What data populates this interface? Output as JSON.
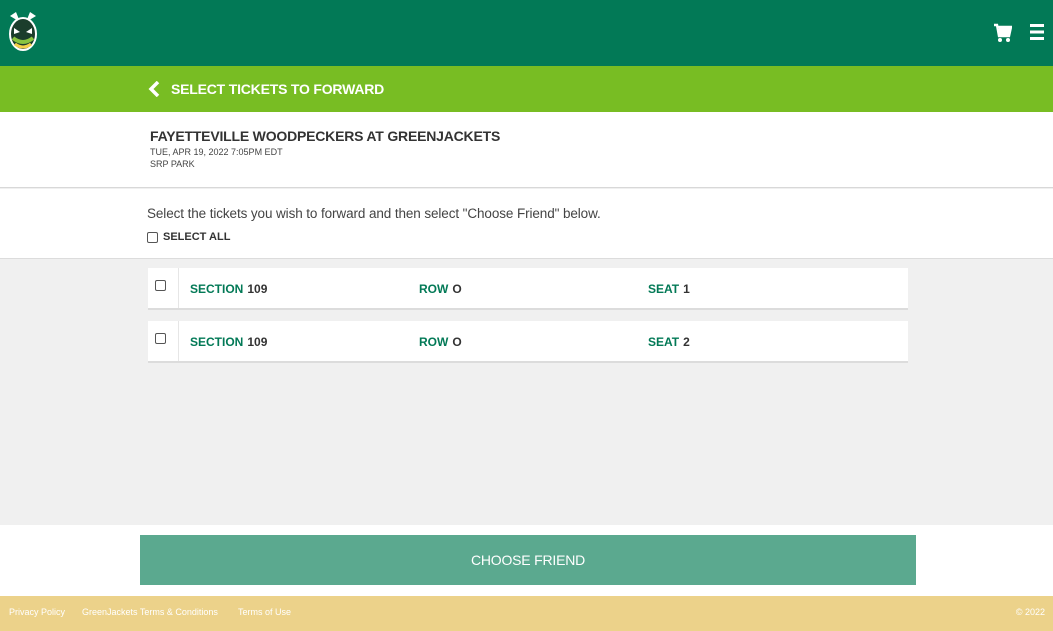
{
  "header": {
    "logo_icon": "hornet-mascot-logo",
    "cart_icon": "cart-icon",
    "menu_icon": "hamburger-menu-icon",
    "colors": {
      "primary": "#027956",
      "accent": "#78bd23"
    }
  },
  "subheader": {
    "back_label": "SELECT TICKETS TO FORWARD"
  },
  "event": {
    "title": "FAYETTEVILLE WOODPECKERS AT GREENJACKETS",
    "date": "TUE, APR 19, 2022 7:05PM EDT",
    "venue": "SRP PARK"
  },
  "instructions": {
    "text": "Select the tickets you wish to forward and then select \"Choose Friend\" below.",
    "select_all_label": "SELECT ALL"
  },
  "tickets": [
    {
      "section_label": "SECTION",
      "section": "109",
      "row_label": "ROW",
      "row": "O",
      "seat_label": "SEAT",
      "seat": "1"
    },
    {
      "section_label": "SECTION",
      "section": "109",
      "row_label": "ROW",
      "row": "O",
      "seat_label": "SEAT",
      "seat": "2"
    }
  ],
  "actions": {
    "choose_friend": "CHOOSE FRIEND"
  },
  "footer": {
    "links": [
      "Privacy Policy",
      "GreenJackets Terms & Conditions",
      "Terms of Use"
    ],
    "copyright": "© 2022"
  }
}
